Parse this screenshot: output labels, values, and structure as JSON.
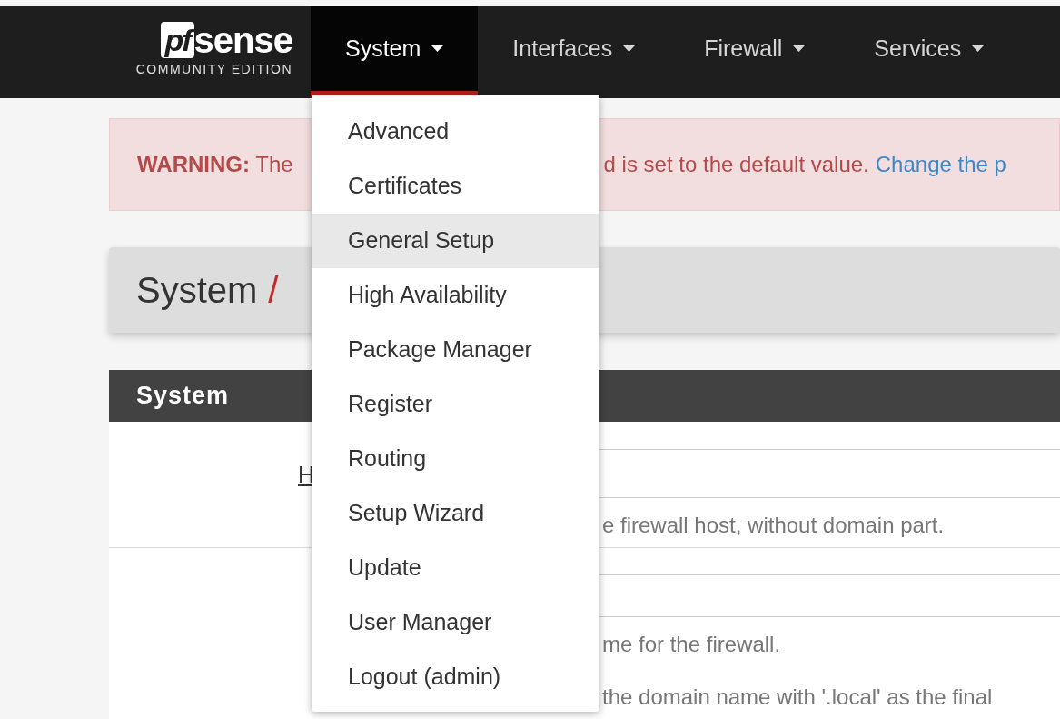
{
  "logo": {
    "badge": "pf",
    "wordmark": "sense",
    "subtitle": "COMMUNITY EDITION"
  },
  "nav": [
    {
      "label": "System",
      "selected": true
    },
    {
      "label": "Interfaces",
      "selected": false
    },
    {
      "label": "Firewall",
      "selected": false
    },
    {
      "label": "Services",
      "selected": false
    }
  ],
  "menu": {
    "items": [
      {
        "label": "Advanced",
        "selected": false
      },
      {
        "label": "Certificates",
        "selected": false
      },
      {
        "label": "General Setup",
        "selected": true
      },
      {
        "label": "High Availability",
        "selected": false
      },
      {
        "label": "Package Manager",
        "selected": false
      },
      {
        "label": "Register",
        "selected": false
      },
      {
        "label": "Routing",
        "selected": false
      },
      {
        "label": "Setup Wizard",
        "selected": false
      },
      {
        "label": "Update",
        "selected": false
      },
      {
        "label": "User Manager",
        "selected": false
      },
      {
        "label": "Logout (admin)",
        "selected": false
      }
    ]
  },
  "warning": {
    "label": "WARNING:",
    "text_start": "The",
    "text_end": "d is set to the default value.",
    "link": "Change the p"
  },
  "breadcrumb": {
    "text": "System",
    "separator": "/"
  },
  "panel": {
    "title": "System",
    "rows": [
      {
        "label": "H",
        "help": "e firewall host, without domain part."
      },
      {
        "help": "me for the firewall.",
        "note": "the domain name with '.local' as the final"
      }
    ]
  }
}
